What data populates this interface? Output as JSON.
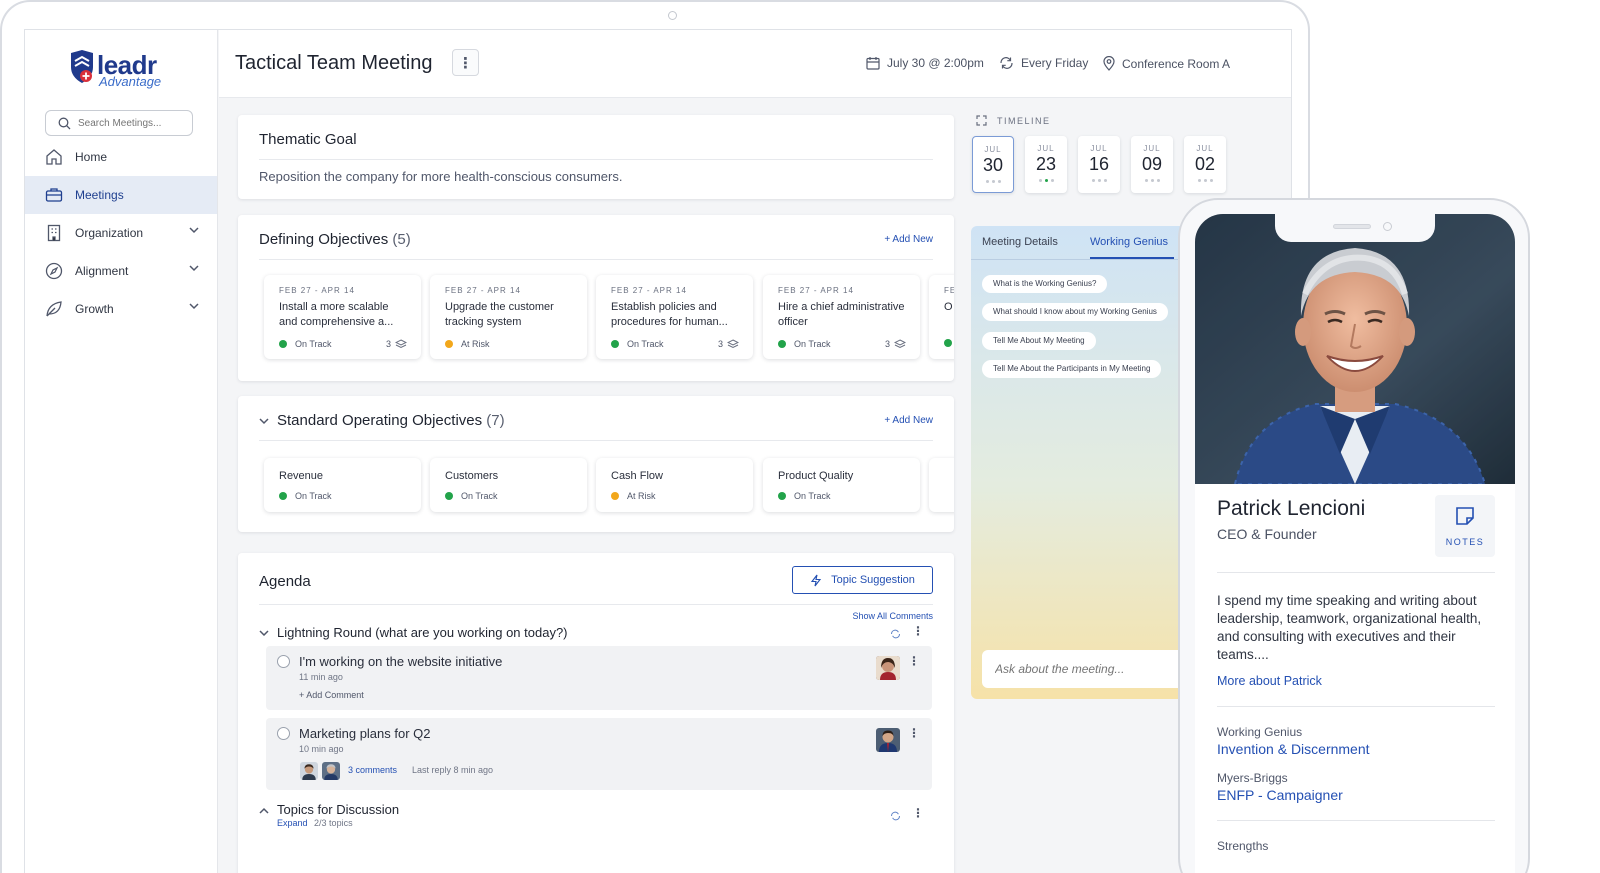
{
  "app": {
    "brand": "leadr",
    "brand_sub": "Advantage",
    "search_placeholder": "Search Meetings..."
  },
  "sidebar": {
    "items": [
      {
        "label": "Home",
        "icon": "home-icon"
      },
      {
        "label": "Meetings",
        "icon": "briefcase-icon"
      },
      {
        "label": "Organization",
        "icon": "building-icon"
      },
      {
        "label": "Alignment",
        "icon": "compass-icon"
      },
      {
        "label": "Growth",
        "icon": "leaf-icon"
      }
    ]
  },
  "header": {
    "title": "Tactical Team Meeting",
    "date": "July 30 @ 2:00pm",
    "recurrence": "Every Friday",
    "location": "Conference Room A"
  },
  "thematic_goal": {
    "title": "Thematic Goal",
    "text": "Reposition the company for more health-conscious consumers."
  },
  "defining_objectives": {
    "title": "Defining Objectives",
    "count": "(5)",
    "add_label": "+ Add New",
    "items": [
      {
        "date": "FEB 27 - APR 14",
        "title": "Install a more scalable and comprehensive a...",
        "status": "On Track",
        "count": "3"
      },
      {
        "date": "FEB 27 - APR 14",
        "title": "Upgrade the customer tracking system",
        "status": "At Risk",
        "count": ""
      },
      {
        "date": "FEB 27 - APR 14",
        "title": "Establish policies and procedures for human...",
        "status": "On Track",
        "count": "3"
      },
      {
        "date": "FEB 27 - APR 14",
        "title": "Hire a chief administrative officer",
        "status": "On Track",
        "count": "3"
      },
      {
        "date": "FE",
        "title": "O",
        "status": "",
        "count": ""
      }
    ]
  },
  "sop_objectives": {
    "title": "Standard Operating Objectives",
    "count": "(7)",
    "add_label": "+ Add New",
    "items": [
      {
        "title": "Revenue",
        "status": "On Track"
      },
      {
        "title": "Customers",
        "status": "On Track"
      },
      {
        "title": "Cash Flow",
        "status": "At Risk"
      },
      {
        "title": "Product Quality",
        "status": "On Track"
      }
    ]
  },
  "agenda": {
    "title": "Agenda",
    "topic_suggestion": "Topic Suggestion",
    "show_all_comments": "Show All Comments",
    "sections": [
      {
        "title": "Lightning Round (what are you working on today?)"
      },
      {
        "title": "Topics for Discussion",
        "expand": "Expand",
        "progress": "2/3 topics"
      }
    ],
    "items": [
      {
        "title": "I'm working on the website initiative",
        "time": "11 min ago",
        "add_comment": "+ Add Comment"
      },
      {
        "title": "Marketing plans for Q2",
        "time": "10 min ago",
        "comments": "3 comments",
        "last_reply": "Last reply 8 min ago"
      }
    ]
  },
  "timeline": {
    "label": "TIMELINE",
    "dates": [
      {
        "month": "JUL",
        "day": "30"
      },
      {
        "month": "JUL",
        "day": "23"
      },
      {
        "month": "JUL",
        "day": "16"
      },
      {
        "month": "JUL",
        "day": "09"
      },
      {
        "month": "JUL",
        "day": "02"
      }
    ]
  },
  "assistant": {
    "tabs": [
      "Meeting Details",
      "Working Genius"
    ],
    "chips": [
      "What is the Working Genius?",
      "What should I know about my Working Genius",
      "Tell Me About My Meeting",
      "Tell Me About the Participants in My Meeting"
    ],
    "ask_placeholder": "Ask about the meeting..."
  },
  "profile": {
    "name": "Patrick Lencioni",
    "role": "CEO & Founder",
    "notes_label": "NOTES",
    "bio": "I spend my time speaking and writing about leadership, teamwork, organizational health, and consulting with executives and their teams....",
    "more_link": "More about Patrick",
    "working_genius_label": "Working Genius",
    "working_genius_value": "Invention & Discernment",
    "myers_briggs_label": "Myers-Briggs",
    "myers_briggs_value": "ENFP - Campaigner",
    "strengths_label": "Strengths"
  },
  "colors": {
    "brand": "#203a8c",
    "accent": "#2450b3",
    "on_track": "#22a34a",
    "at_risk": "#f2a71b"
  }
}
